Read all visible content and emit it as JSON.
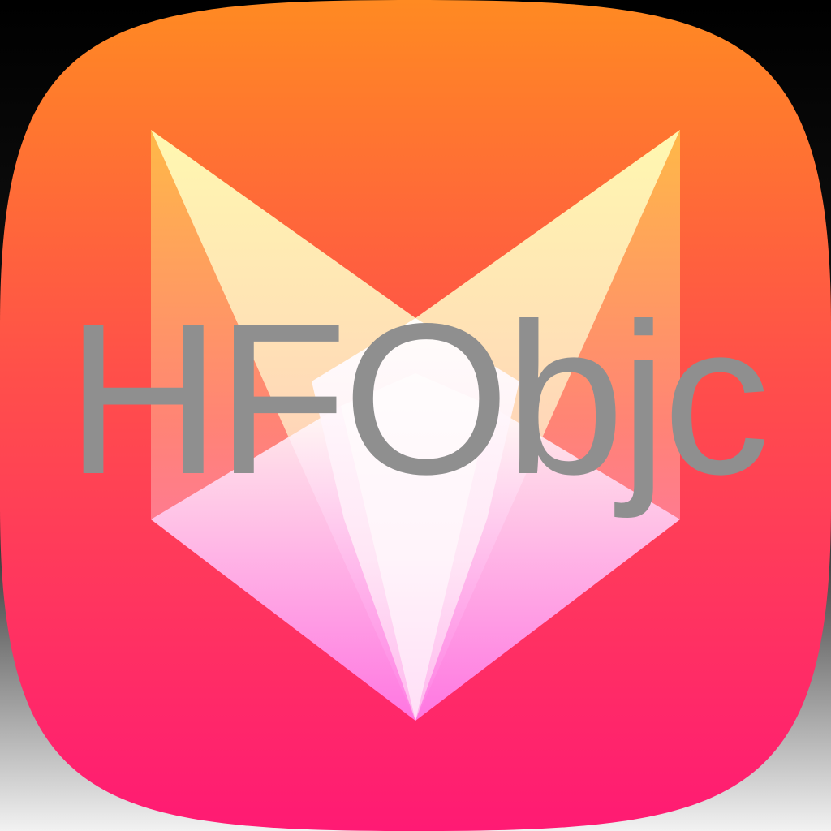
{
  "app_icon": {
    "text": "HFObjc",
    "text_color": "#8f8f8f",
    "gradient_top": "#ff7f2a",
    "gradient_bottom": "#ff1a74",
    "emblem": "fox-head-icon"
  }
}
